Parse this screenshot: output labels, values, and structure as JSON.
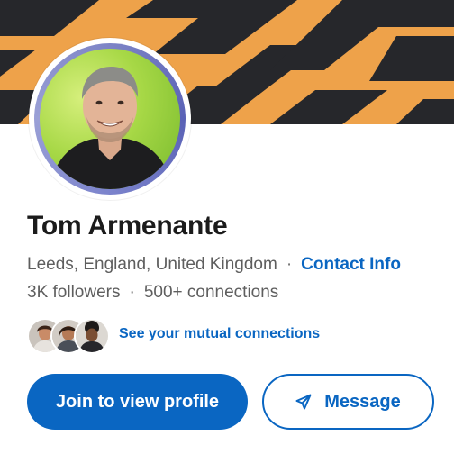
{
  "profile": {
    "name": "Tom Armenante",
    "location": "Leeds, England, United Kingdom",
    "contact_info_label": "Contact Info",
    "separator": "·",
    "followers": "3K followers",
    "connections": "500+ connections"
  },
  "mutual": {
    "label": "See your mutual connections",
    "avatar_count": 3
  },
  "actions": {
    "join_label": "Join to view profile",
    "message_label": "Message",
    "message_icon": "send-icon"
  },
  "colors": {
    "brand_blue": "#0a66c2",
    "banner_orange": "#eea24a",
    "banner_dark": "#26272b"
  }
}
